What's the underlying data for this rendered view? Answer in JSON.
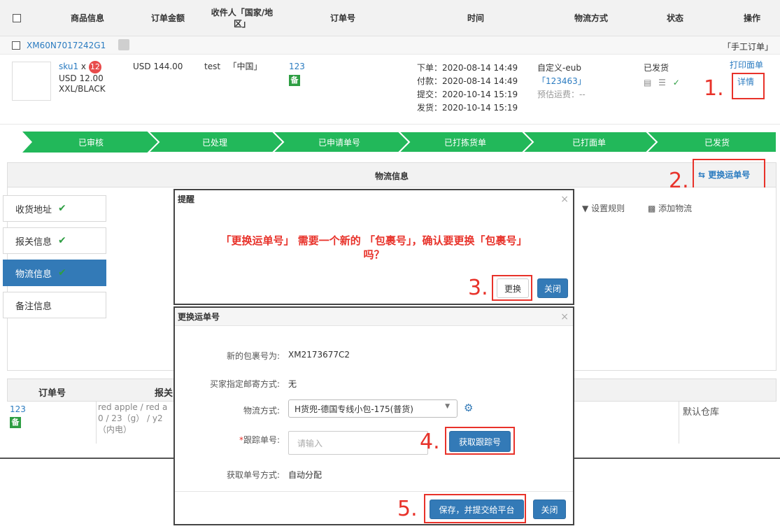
{
  "table_header": {
    "product_info": "商品信息",
    "order_amount": "订单金额",
    "recipient": "收件人「国家/地区」",
    "order_no": "订单号",
    "time": "时间",
    "logistics": "物流方式",
    "status": "状态",
    "action": "操作"
  },
  "order": {
    "id": "XM60N7017242G1",
    "tag": "「手工订单」",
    "sku": "sku1",
    "sku_x": "x",
    "qty": "12",
    "price": "USD 12.00",
    "variant": "XXL/BLACK",
    "amount": "USD 144.00",
    "recipient_name": "test",
    "recipient_country": "「中国」",
    "order_no": "123",
    "badge": "备",
    "time_order": "下单：2020-08-14 14:49",
    "time_pay": "付款：2020-08-14 14:49",
    "time_submit": "提交：2020-10-14 15:19",
    "time_ship": "发货：2020-10-14 15:19",
    "logistics_name": "自定义-eub",
    "tracking": "「123463」",
    "est_freight": "预估运费：--",
    "status": "已发货",
    "print_label": "打印面单",
    "detail": "详情"
  },
  "flow": [
    "已审核",
    "已处理",
    "已申请单号",
    "已打拣货单",
    "已打面单",
    "已发货"
  ],
  "panel": {
    "title": "物流信息",
    "change_tracking": "更换运单号",
    "set_rule": "设置规则",
    "add_logistics": "添加物流"
  },
  "sidebar": [
    {
      "label": "收货地址",
      "check": "✔"
    },
    {
      "label": "报关信息",
      "check": "✔"
    },
    {
      "label": "物流信息",
      "check": "✔"
    },
    {
      "label": "备注信息",
      "check": ""
    }
  ],
  "reminder_dialog": {
    "title": "提醒",
    "message_line1": "「更换运单号」 需要一个新的 「包裹号」，确认要更换「包裹号」",
    "message_line2": "吗？",
    "confirm": "更换",
    "close": "关闭"
  },
  "change_dialog": {
    "title": "更换运单号",
    "new_package_label": "新的包裹号为:",
    "new_package_value": "XM2173677C2",
    "buyer_method_label": "买家指定邮寄方式:",
    "buyer_method_value": "无",
    "logistics_label": "物流方式:",
    "logistics_value": "H货兜-德国专线小包-175(普货)",
    "tracking_label": "跟踪单号:",
    "tracking_required": "*",
    "tracking_placeholder": "请输入",
    "get_tracking": "获取跟踪号",
    "fetch_method_label": "获取单号方式:",
    "fetch_method_value": "自动分配",
    "save_submit": "保存，并提交给平台",
    "close": "关闭"
  },
  "bottom_table": {
    "col_order_no": "订单号",
    "col_customs": "报关",
    "order_no": "123",
    "badge": "备",
    "customs_line1": "red apple / red a",
    "customs_line2": "0 / 23（g） / y2",
    "customs_line3": "（内电）",
    "warehouse": "默认仓库"
  },
  "steps": [
    "1.",
    "2.",
    "3.",
    "4.",
    "5."
  ],
  "colors": {
    "accent": "#337ab7",
    "flow_green": "#22b85a",
    "annotation_red": "#e8322a",
    "check_green": "#2e9e43"
  }
}
